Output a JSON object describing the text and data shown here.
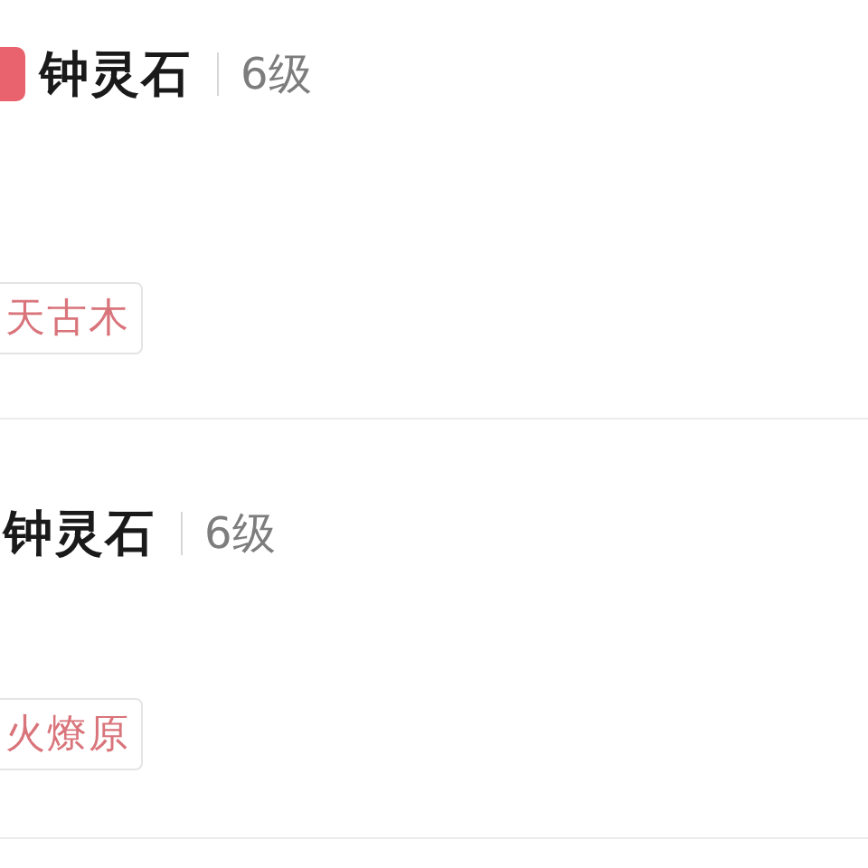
{
  "cards": [
    {
      "has_badge": true,
      "title": "钟灵石",
      "level_text": "6级",
      "tag": "天古木"
    },
    {
      "has_badge": false,
      "title": "钟灵石",
      "level_text": "6级",
      "tag": "火燎原"
    }
  ]
}
